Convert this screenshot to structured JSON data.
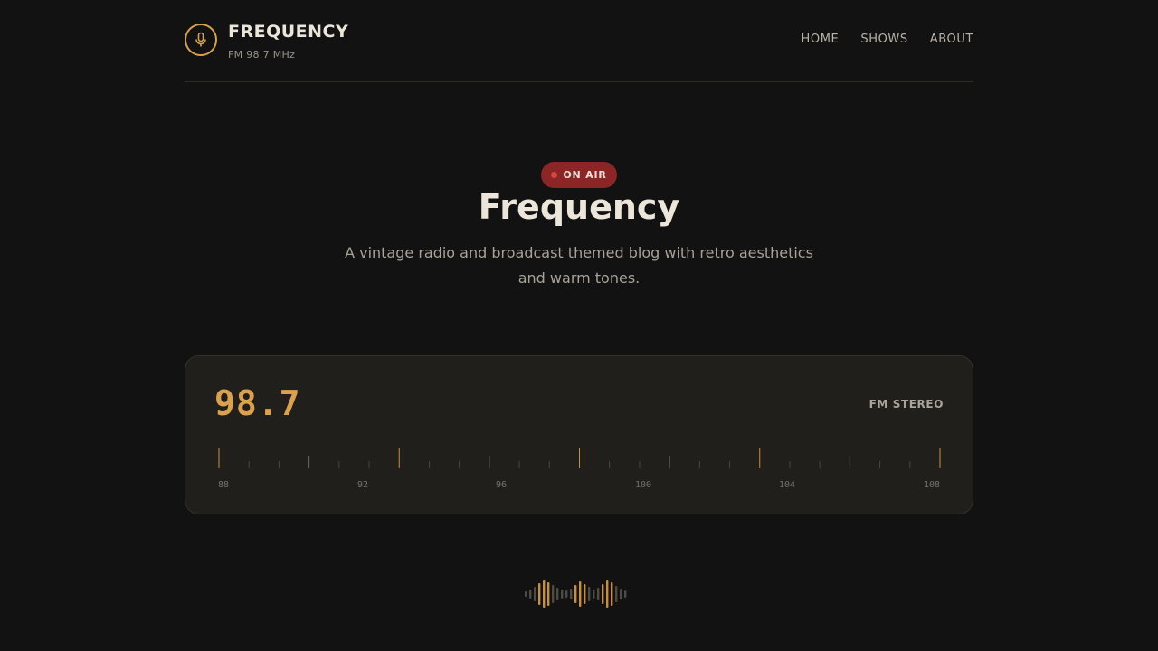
{
  "header": {
    "brand": "FREQUENCY",
    "station": "FM 98.7 MHz",
    "nav": [
      "HOME",
      "SHOWS",
      "ABOUT"
    ]
  },
  "hero": {
    "badge": "ON AIR",
    "title": "Frequency",
    "subtitle_line1": "A vintage radio and broadcast themed blog with retro aesthetics",
    "subtitle_line2": "and warm tones."
  },
  "tuner": {
    "frequency": "98.7",
    "mode": "FM STEREO",
    "scale_labels": [
      "88",
      "92",
      "96",
      "100",
      "104",
      "108"
    ]
  },
  "colors": {
    "accent": "#dba14d",
    "on_air": "#8c2626",
    "background": "#121212",
    "card": "#211f1c"
  },
  "icons": {
    "logo": "microphone-icon"
  }
}
